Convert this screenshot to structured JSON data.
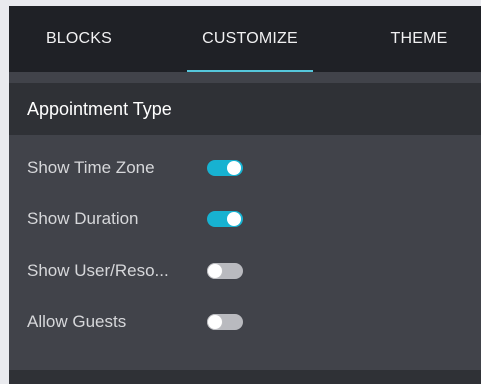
{
  "tabs": {
    "blocks": "BLOCKS",
    "customize": "CUSTOMIZE",
    "theme": "THEME",
    "active": "CUSTOMIZE"
  },
  "section": {
    "title": "Appointment Type"
  },
  "options": [
    {
      "label": "Show Time Zone",
      "enabled": true
    },
    {
      "label": "Show Duration",
      "enabled": true
    },
    {
      "label": "Show User/Reso...",
      "enabled": false
    },
    {
      "label": "Allow Guests",
      "enabled": false
    }
  ],
  "colors": {
    "accent": "#17b2d1",
    "tab_bar": "#1f2126",
    "panel": "#41434a",
    "section_header": "#2f3136"
  }
}
